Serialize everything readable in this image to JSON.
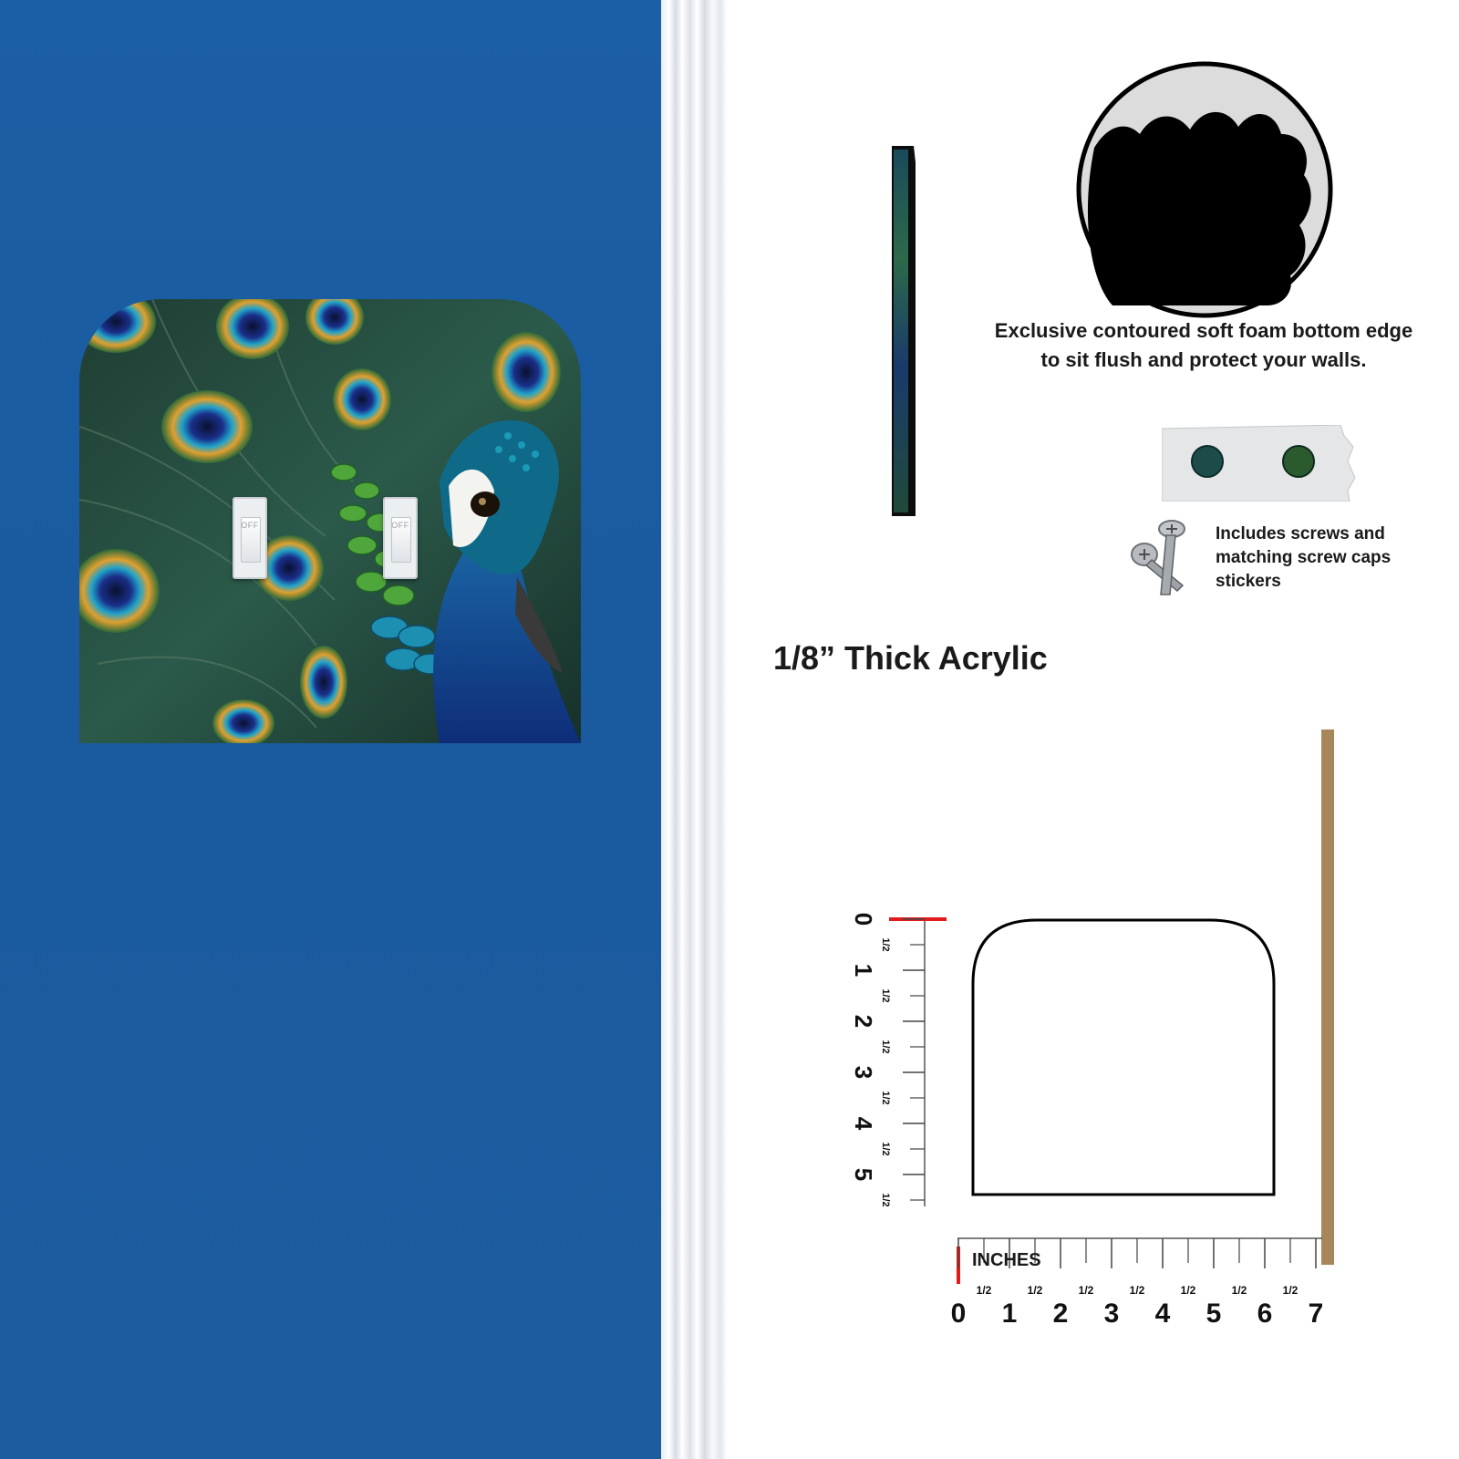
{
  "scene": {
    "wall_color": "#1b5fa6",
    "plate": {
      "art": "peacock feathers",
      "colors": [
        "#0d3b6e",
        "#1d8a9c",
        "#2f8a3b",
        "#e09b2d",
        "#0a1a2e"
      ],
      "switches": [
        {
          "label": "OFF"
        },
        {
          "label": "OFF"
        }
      ]
    }
  },
  "features": {
    "foam_text": "Exclusive contoured soft foam bottom edge to sit flush and protect your walls.",
    "screws_text": "Includes screws and matching screw caps stickers",
    "thickness_text": "1/8” Thick Acrylic"
  },
  "ruler": {
    "units_label": "INCHES",
    "vertical_numbers": [
      "0",
      "1",
      "2",
      "3",
      "4",
      "5"
    ],
    "horizontal_numbers": [
      "0",
      "1",
      "2",
      "3",
      "4",
      "5",
      "6",
      "7"
    ],
    "half_label": "1/2",
    "zero_color": "#e01b1b",
    "shim_color": "#a7875a"
  }
}
